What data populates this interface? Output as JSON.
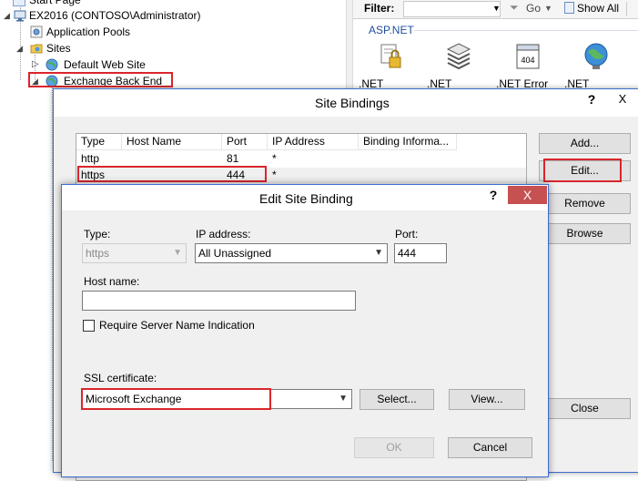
{
  "tree": {
    "items": [
      {
        "label": "Start Page"
      },
      {
        "label": "EX2016 (CONTOSO\\Administrator)"
      },
      {
        "label": "Application Pools"
      },
      {
        "label": "Sites"
      },
      {
        "label": "Default Web Site"
      },
      {
        "label": "Exchange Back End"
      }
    ]
  },
  "features": {
    "filter_label": "Filter:",
    "go_label": "Go",
    "show_all_label": "Show All",
    "group_label": "ASP.NET",
    "items": [
      {
        "label": ".NET",
        "icon": "dotnet-authorization-icon"
      },
      {
        "label": ".NET",
        "icon": "dotnet-compilation-icon"
      },
      {
        "label": ".NET Error",
        "icon": "dotnet-error-pages-icon",
        "badge": "404"
      },
      {
        "label": ".NET",
        "icon": "dotnet-globalization-icon"
      }
    ]
  },
  "site_bindings": {
    "title": "Site Bindings",
    "help_glyph": "?",
    "close_glyph": "X",
    "columns": [
      "Type",
      "Host Name",
      "Port",
      "IP Address",
      "Binding Informa..."
    ],
    "rows": [
      {
        "type": "http",
        "host": "",
        "port": "81",
        "ip": "*",
        "info": ""
      },
      {
        "type": "https",
        "host": "",
        "port": "444",
        "ip": "*",
        "info": ""
      }
    ],
    "buttons": {
      "add": "Add...",
      "edit": "Edit...",
      "remove": "Remove",
      "browse": "Browse",
      "close": "Close"
    }
  },
  "edit_binding": {
    "title": "Edit Site Binding",
    "help_glyph": "?",
    "close_glyph": "X",
    "type_label": "Type:",
    "type_value": "https",
    "ip_label": "IP address:",
    "ip_value": "All Unassigned",
    "port_label": "Port:",
    "port_value": "444",
    "host_label": "Host name:",
    "host_value": "",
    "sni_label": "Require Server Name Indication",
    "sni_checked": false,
    "ssl_label": "SSL certificate:",
    "ssl_value": "Microsoft Exchange",
    "select_button": "Select...",
    "view_button": "View...",
    "ok_button": "OK",
    "cancel_button": "Cancel"
  },
  "colors": {
    "highlight_box": "#d9262b",
    "dialog_border": "#3c6ecc",
    "close_button": "#c75050"
  }
}
